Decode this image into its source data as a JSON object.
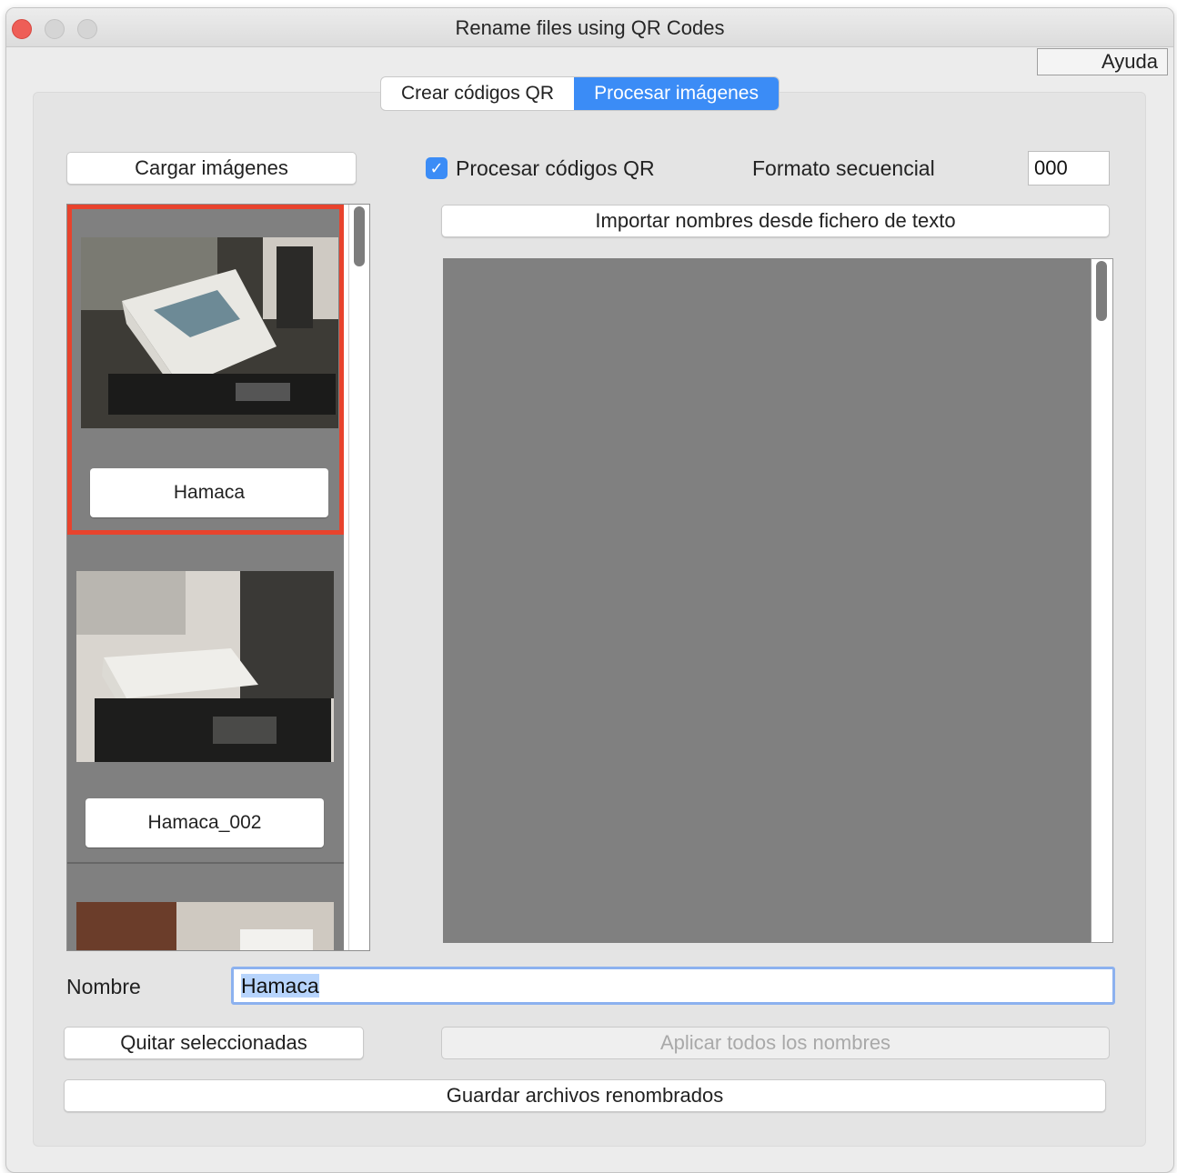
{
  "window": {
    "title": "Rename files using QR Codes"
  },
  "help_button": "Ayuda",
  "tabs": [
    {
      "label": "Crear códigos QR",
      "active": false
    },
    {
      "label": "Procesar imágenes",
      "active": true
    }
  ],
  "left": {
    "load_button": "Cargar imágenes",
    "images": [
      {
        "name": "Hamaca",
        "selected": true
      },
      {
        "name": "Hamaca_002",
        "selected": false
      },
      {
        "name": "",
        "selected": false
      }
    ]
  },
  "options": {
    "process_qr_label": "Procesar códigos QR",
    "process_qr_checked": true,
    "seq_format_label": "Formato secuencial",
    "seq_format_value": "000",
    "import_names_button": "Importar nombres desde fichero de texto"
  },
  "name_field": {
    "label": "Nombre",
    "value": "Hamaca"
  },
  "buttons": {
    "remove_selected": "Quitar seleccionadas",
    "apply_all_names": "Aplicar todos los nombres",
    "save_renamed": "Guardar archivos renombrados"
  },
  "colors": {
    "accent": "#3b8cf6",
    "selection_border": "#e8432d",
    "preview_bg": "#808080"
  }
}
